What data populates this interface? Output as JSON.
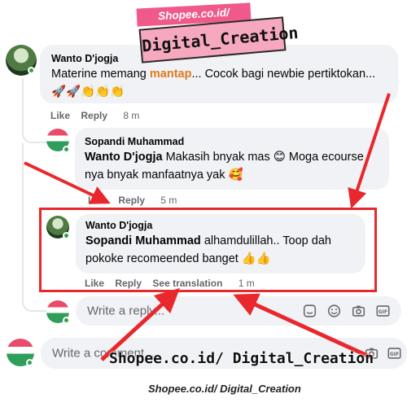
{
  "watermark": {
    "site_badge": "Shopee.co.id/",
    "name_badge": "Digital_Creation",
    "footer_big": "Shopee.co.id/ Digital_Creation",
    "footer_small": "Shopee.co.id/ Digital_Creation"
  },
  "comments": [
    {
      "author": "Wanto D'jogja",
      "text_pre": "Materine memang ",
      "text_highlight": "mantap",
      "text_post": "... Cocok bagi newbie pertiktokan...🚀🚀👏👏👏",
      "actions": {
        "like": "Like",
        "reply": "Reply",
        "time": "8 m"
      }
    },
    {
      "author": "Sopandi Muhammad",
      "mention": "Wanto D'jogja",
      "text": " Makasih bnyak mas 😊 Moga ecourse nya bnyak manfaatnya yak 🥰",
      "actions": {
        "like": "Like",
        "reply": "Reply",
        "time": "5 m"
      }
    },
    {
      "author": "Wanto D'jogja",
      "mention": "Sopandi Muhammad",
      "text": " alhamdulillah.. Toop dah pokoke recomeended banget 👍👍",
      "actions": {
        "like": "Like",
        "reply": "Reply",
        "see_translation": "See translation",
        "time": "1 m"
      }
    }
  ],
  "reply_input": {
    "placeholder": "Write a reply..."
  },
  "comment_input": {
    "placeholder": "Write a comment..."
  },
  "input_tools": [
    "sticker-icon",
    "emoji-icon",
    "camera-icon",
    "gif-icon",
    "sticker-face-icon"
  ],
  "colors": {
    "highlight_box": "#e8282c",
    "arrow": "#e8282c",
    "online": "#31a24c",
    "bubble": "#f0f2f5"
  }
}
